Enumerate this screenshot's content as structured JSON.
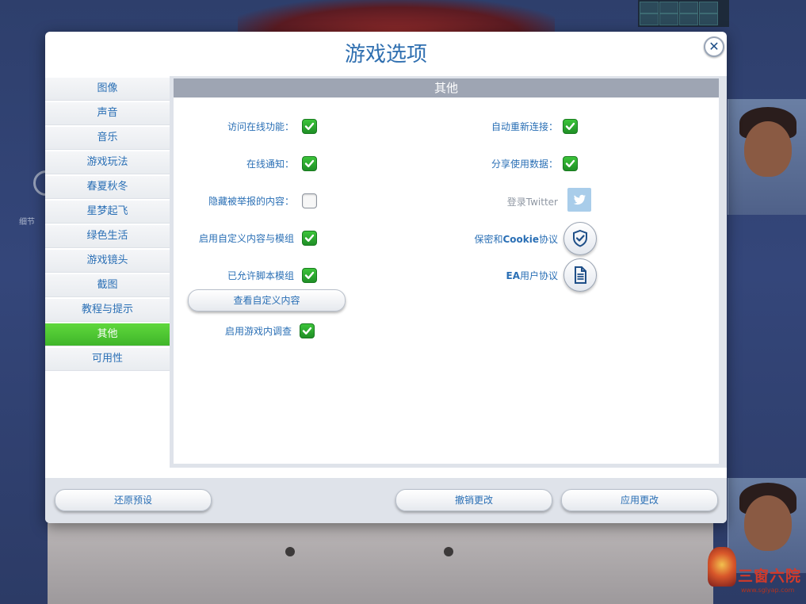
{
  "background": {
    "left_label": "细节"
  },
  "dialog": {
    "title": "游戏选项",
    "close_symbol": "✕"
  },
  "sidebar": {
    "items": [
      {
        "label": "图像"
      },
      {
        "label": "声音"
      },
      {
        "label": "音乐"
      },
      {
        "label": "游戏玩法"
      },
      {
        "label": "春夏秋冬"
      },
      {
        "label": "星梦起飞"
      },
      {
        "label": "绿色生活"
      },
      {
        "label": "游戏镜头"
      },
      {
        "label": "截图"
      },
      {
        "label": "教程与提示"
      },
      {
        "label": "其他",
        "active": true
      },
      {
        "label": "可用性"
      }
    ]
  },
  "panel": {
    "header": "其他",
    "left_options": [
      {
        "label": "访问在线功能：",
        "checked": true
      },
      {
        "label": "在线通知：",
        "checked": true
      },
      {
        "label": "隐藏被举报的内容：",
        "checked": false
      },
      {
        "label": "启用自定义内容与模组",
        "checked": true
      },
      {
        "label": "已允许脚本模组",
        "checked": true
      }
    ],
    "view_custom_content_button": "查看自定义内容",
    "survey_option": {
      "label": "启用游戏内调查",
      "checked": true
    },
    "right_options": [
      {
        "label": "自动重新连接：",
        "checked": true
      },
      {
        "label": "分享使用数据：",
        "checked": true
      }
    ],
    "twitter_login": "登录Twitter",
    "privacy_cookie": {
      "prefix": "保密和",
      "bold": "Cookie",
      "suffix": "协议"
    },
    "ea_user_agreement": {
      "bold": "EA",
      "suffix": "用户协议"
    }
  },
  "footer": {
    "restore_button": "还原预设",
    "undo_button": "撤销更改",
    "apply_button": "应用更改"
  },
  "watermark": {
    "text": "三窗六院",
    "url": "www.sglyap.com"
  },
  "colors": {
    "accent_blue": "#2a6fb5",
    "active_green": "#4cc432",
    "check_green": "#2aa530",
    "header_gray": "#9ea5b3"
  }
}
